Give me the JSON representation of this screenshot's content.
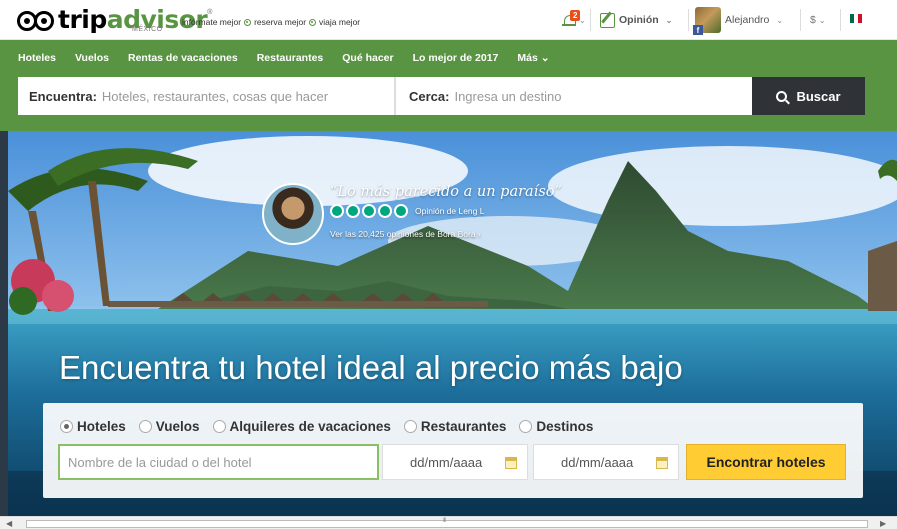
{
  "header": {
    "logo_trip": "trip",
    "logo_advisor": "advisor",
    "logo_reg": "®",
    "country": "MÉXICO",
    "tagline": [
      "infórmate mejor",
      "reserva mejor",
      "viaja mejor"
    ],
    "notif_count": "2",
    "opinion_label": "Opinión",
    "user_name": "Alejandro",
    "currency_label": "$",
    "brand_color": "#589442"
  },
  "nav": {
    "items": [
      "Hoteles",
      "Vuelos",
      "Rentas de vacaciones",
      "Restaurantes",
      "Qué hacer",
      "Lo mejor de 2017",
      "Más ⌄"
    ]
  },
  "search": {
    "find_label": "Encuentra:",
    "find_placeholder": "Hoteles, restaurantes, cosas que hacer",
    "near_label": "Cerca:",
    "near_placeholder": "Ingresa un destino",
    "button_label": "Buscar"
  },
  "hero": {
    "quote": "“Lo más parecido a un paraíso”",
    "review_by": "Opinión de Leng L",
    "rating_bubbles": 5,
    "reviews_link": "Ver las 20,425 opiniones de Bora Bora ›",
    "title": "Encuentra tu hotel ideal al precio más bajo"
  },
  "booking": {
    "options": [
      {
        "label": "Hoteles",
        "checked": true
      },
      {
        "label": "Vuelos",
        "checked": false
      },
      {
        "label": "Alquileres de vacaciones",
        "checked": false
      },
      {
        "label": "Restaurantes",
        "checked": false
      },
      {
        "label": "Destinos",
        "checked": false
      }
    ],
    "city_placeholder": "Nombre de la ciudad o del hotel",
    "checkin_placeholder": "dd/mm/aaaa",
    "checkout_placeholder": "dd/mm/aaaa",
    "submit_label": "Encontrar hoteles",
    "accent_color": "#ffcc33"
  },
  "scrollbar": {
    "grip": "III"
  }
}
